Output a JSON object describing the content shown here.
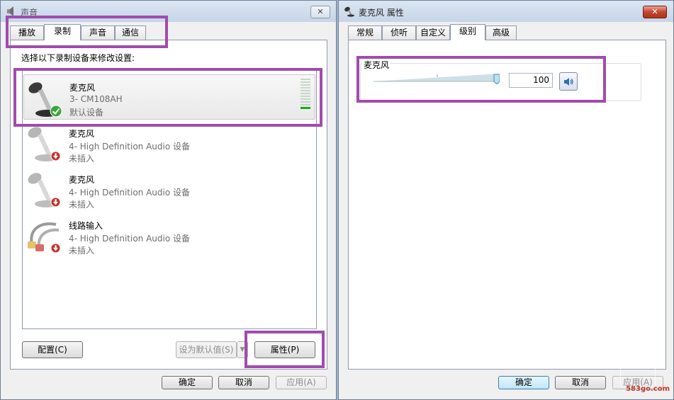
{
  "left_window": {
    "title": "声音",
    "close_label": "✕",
    "tabs": [
      {
        "label": "播放"
      },
      {
        "label": "录制"
      },
      {
        "label": "声音"
      },
      {
        "label": "通信"
      }
    ],
    "instruction": "选择以下录制设备来修改设置:",
    "devices": [
      {
        "name": "麦克风",
        "desc": "3- CM108AH",
        "state": "默认设备",
        "status_icon": "check-icon",
        "selected": true
      },
      {
        "name": "麦克风",
        "desc": "4- High Definition Audio 设备",
        "state": "未插入",
        "status_icon": "unplugged-icon",
        "selected": false
      },
      {
        "name": "麦克风",
        "desc": "4- High Definition Audio 设备",
        "state": "未插入",
        "status_icon": "unplugged-icon",
        "selected": false
      },
      {
        "name": "线路输入",
        "desc": "4- High Definition Audio 设备",
        "state": "未插入",
        "status_icon": "unplugged-icon",
        "selected": false
      }
    ],
    "buttons": {
      "configure": "配置(C)",
      "set_default": "设为默认值(S)",
      "properties": "属性(P)",
      "ok": "确定",
      "cancel": "取消",
      "apply": "应用(A)"
    }
  },
  "right_window": {
    "title": "麦克风 属性",
    "close_label": "✕",
    "tabs": [
      {
        "label": "常规"
      },
      {
        "label": "侦听"
      },
      {
        "label": "自定义"
      },
      {
        "label": "级别"
      },
      {
        "label": "高级"
      }
    ],
    "level_group_label": "麦克风",
    "level": 100,
    "level_text": "100",
    "buttons": {
      "ok": "确定",
      "cancel": "取消",
      "apply": "应用(A)"
    }
  },
  "watermark": "583go.com",
  "colors": {
    "highlight": "#a14bad",
    "check": "#3aa53a",
    "unplugged": "#c8302a",
    "meter_green": "#1fa51f"
  }
}
